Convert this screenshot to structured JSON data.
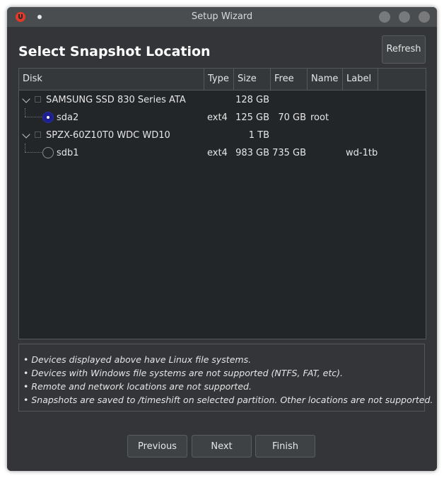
{
  "window": {
    "title": "Setup Wizard"
  },
  "page": {
    "heading": "Select Snapshot Location",
    "refresh_label": "Refresh"
  },
  "table": {
    "columns": [
      "Disk",
      "Type",
      "Size",
      "Free",
      "Name",
      "Label"
    ],
    "rows": [
      {
        "kind": "disk",
        "disk": "SAMSUNG SSD 830 Series ATA",
        "type": "",
        "size": "128 GB",
        "free": "",
        "name": "",
        "label": ""
      },
      {
        "kind": "partition",
        "selected": true,
        "disk": "sda2",
        "type": "ext4",
        "size": "125 GB",
        "free": "70 GB",
        "name": "root",
        "label": ""
      },
      {
        "kind": "disk",
        "disk": "SPZX-60Z10T0 WDC WD10",
        "type": "",
        "size": "1 TB",
        "free": "",
        "name": "",
        "label": ""
      },
      {
        "kind": "partition",
        "selected": false,
        "disk": "sdb1",
        "type": "ext4",
        "size": "983 GB",
        "free": "735 GB",
        "name": "",
        "label": "wd-1tb"
      }
    ]
  },
  "notes": [
    "• Devices displayed above have Linux file systems.",
    "• Devices with Windows file systems are not supported (NTFS, FAT, etc).",
    "• Remote and network locations are not supported.",
    "• Snapshots are saved to /timeshift on selected partition. Other locations are not supported."
  ],
  "buttons": {
    "previous": "Previous",
    "next": "Next",
    "finish": "Finish"
  },
  "colors": {
    "window_bg": "#333538",
    "table_bg": "#232629",
    "radio_selected": "#1c1f8d"
  }
}
